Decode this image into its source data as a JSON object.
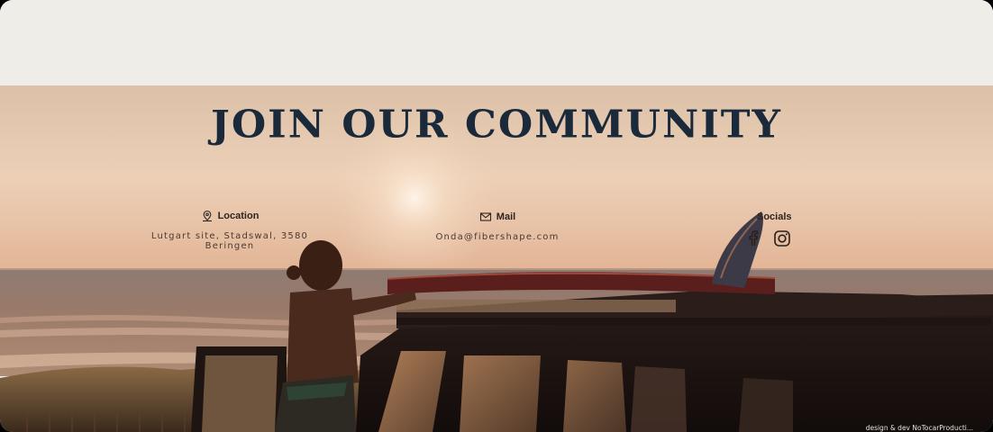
{
  "hero": {
    "title": "JOIN OUR COMMUNITY"
  },
  "contact": {
    "location": {
      "label": "Location",
      "value": "Lutgart site, Stadswal, 3580 Beringen",
      "icon": "location-pin-icon"
    },
    "mail": {
      "label": "Mail",
      "value": "Onda@fibershape.com",
      "icon": "envelope-icon"
    },
    "socials": {
      "label": "Socials",
      "icons": [
        "facebook-icon",
        "instagram-icon"
      ]
    }
  },
  "footer": {
    "credit": "design & dev NoTocarProducti..."
  },
  "colors": {
    "background": "#efede8",
    "title": "#1b2a3a",
    "sky_top": "#e9cdb2",
    "sea": "#8a6e62"
  }
}
